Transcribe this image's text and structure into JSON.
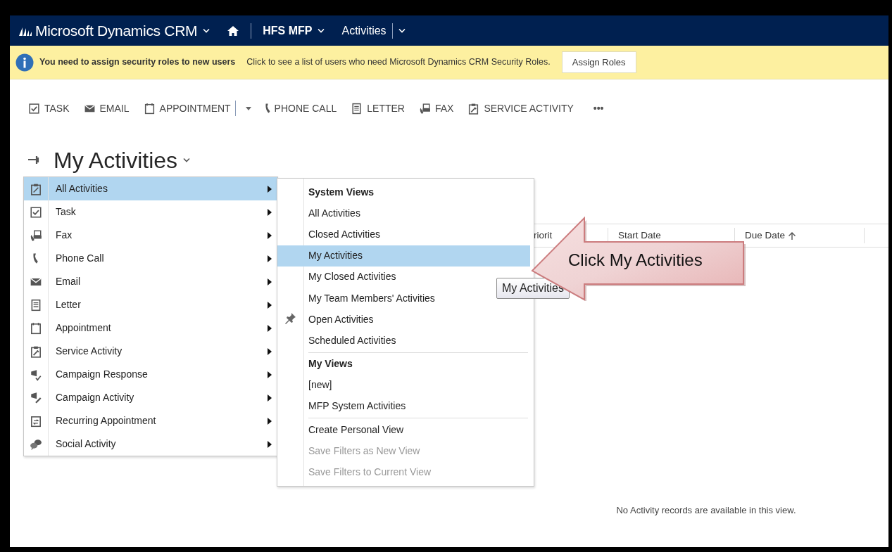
{
  "nav": {
    "app_title": "Microsoft Dynamics CRM",
    "breadcrumbs": [
      {
        "label": "HFS MFP",
        "bold": true
      },
      {
        "label": "Activities",
        "bold": false
      }
    ]
  },
  "notification": {
    "title": "You need to assign security roles to new users",
    "message": "Click to see a list of users who need Microsoft Dynamics CRM Security Roles.",
    "button": "Assign Roles"
  },
  "toolbar": {
    "items": [
      {
        "kind": "task",
        "label": "TASK",
        "dropdown": false
      },
      {
        "kind": "email",
        "label": "EMAIL",
        "dropdown": false
      },
      {
        "kind": "appointment",
        "label": "APPOINTMENT",
        "dropdown": true
      },
      {
        "kind": "phone",
        "label": "PHONE CALL",
        "dropdown": false
      },
      {
        "kind": "letter",
        "label": "LETTER",
        "dropdown": false
      },
      {
        "kind": "fax",
        "label": "FAX",
        "dropdown": false
      },
      {
        "kind": "service",
        "label": "SERVICE ACTIVITY",
        "dropdown": false
      }
    ],
    "more": "•••"
  },
  "view": {
    "title": "My Activities"
  },
  "grid": {
    "columns": [
      {
        "label": "riorit",
        "sorted_ascending": false
      },
      {
        "label": "Start Date",
        "sorted_ascending": false
      },
      {
        "label": "Due Date",
        "sorted_ascending": true
      }
    ],
    "empty_message": "No Activity records are available in this view."
  },
  "type_menu": {
    "items": [
      {
        "kind": "all",
        "label": "All Activities",
        "selected": true
      },
      {
        "kind": "task",
        "label": "Task",
        "selected": false
      },
      {
        "kind": "fax",
        "label": "Fax",
        "selected": false
      },
      {
        "kind": "phone",
        "label": "Phone Call",
        "selected": false
      },
      {
        "kind": "email",
        "label": "Email",
        "selected": false
      },
      {
        "kind": "letter",
        "label": "Letter",
        "selected": false
      },
      {
        "kind": "appointment",
        "label": "Appointment",
        "selected": false
      },
      {
        "kind": "service",
        "label": "Service Activity",
        "selected": false
      },
      {
        "kind": "campaign_response",
        "label": "Campaign Response",
        "selected": false
      },
      {
        "kind": "campaign_activity",
        "label": "Campaign Activity",
        "selected": false
      },
      {
        "kind": "recurring",
        "label": "Recurring Appointment",
        "selected": false
      },
      {
        "kind": "social",
        "label": "Social Activity",
        "selected": false
      }
    ]
  },
  "view_menu": {
    "sections": [
      {
        "title": "System Views",
        "items": [
          {
            "label": "All Activities",
            "selected": false,
            "pinned": false,
            "disabled": false
          },
          {
            "label": "Closed Activities",
            "selected": false,
            "pinned": false,
            "disabled": false
          },
          {
            "label": "My Activities",
            "selected": true,
            "pinned": false,
            "disabled": false
          },
          {
            "label": "My Closed Activities",
            "selected": false,
            "pinned": false,
            "disabled": false
          },
          {
            "label": "My Team Members' Activities",
            "selected": false,
            "pinned": false,
            "disabled": false
          },
          {
            "label": "Open Activities",
            "selected": false,
            "pinned": true,
            "disabled": false
          },
          {
            "label": "Scheduled Activities",
            "selected": false,
            "pinned": false,
            "disabled": false
          }
        ]
      },
      {
        "title": "My Views",
        "items": [
          {
            "label": "[new]",
            "selected": false,
            "pinned": false,
            "disabled": false
          },
          {
            "label": "MFP System Activities",
            "selected": false,
            "pinned": false,
            "disabled": false
          }
        ]
      },
      {
        "items": [
          {
            "label": "Create Personal View",
            "selected": false,
            "pinned": false,
            "disabled": false
          },
          {
            "label": "Save Filters as New View",
            "selected": false,
            "pinned": false,
            "disabled": true
          },
          {
            "label": "Save Filters to Current View",
            "selected": false,
            "pinned": false,
            "disabled": true
          }
        ]
      }
    ]
  },
  "tooltip": "My Activities",
  "callout": "Click My Activities"
}
